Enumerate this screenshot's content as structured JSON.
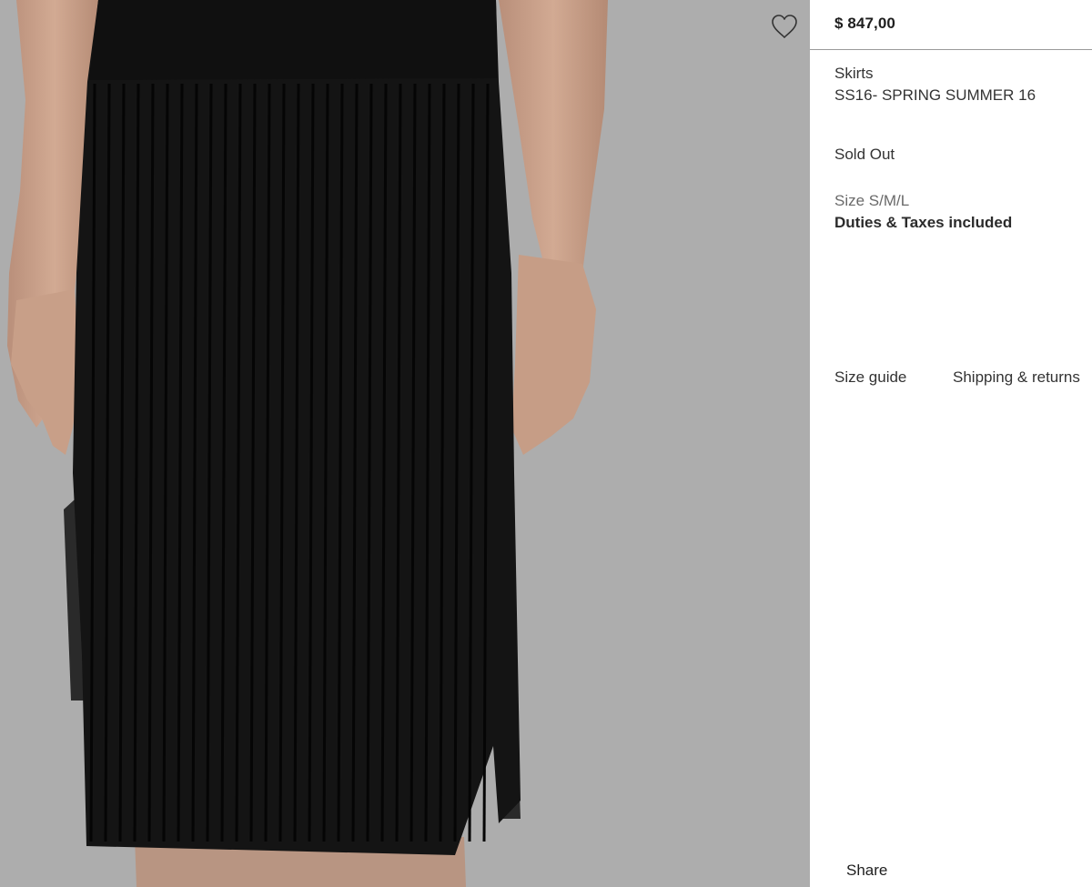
{
  "product": {
    "price": "$ 847,00",
    "category": "Skirts",
    "season": "SS16- SPRING SUMMER 16",
    "stock_status": "Sold Out",
    "size": "Size S/M/L",
    "duties": "Duties & Taxes included"
  },
  "links": {
    "size_guide": "Size guide",
    "shipping_returns": "Shipping & returns"
  },
  "share_label": "Share",
  "icons": {
    "wishlist": "heart-outline-icon"
  },
  "colors": {
    "photo_background": "#adadad",
    "garment": "#141414",
    "text": "#333333",
    "divider": "#9a9a9a"
  }
}
